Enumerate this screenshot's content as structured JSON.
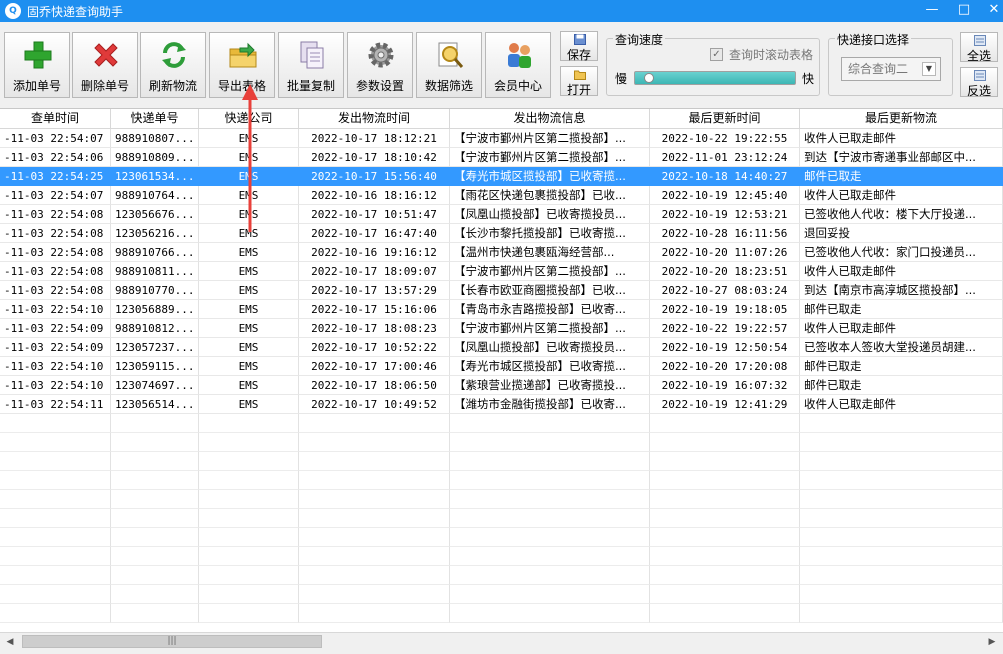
{
  "window": {
    "title": "固乔快递查询助手",
    "app_icon_text": "Q",
    "minimize": "—",
    "maximize": "□",
    "close": "✕"
  },
  "toolbar": {
    "add": "添加单号",
    "delete": "删除单号",
    "refresh": "刷新物流",
    "export": "导出表格",
    "batch_copy": "批量复制",
    "settings": "参数设置",
    "filter": "数据筛选",
    "member": "会员中心",
    "save": "保存",
    "open": "打开"
  },
  "speed": {
    "title": "查询速度",
    "scroll_label": "查询时滚动表格",
    "scroll_checked": true,
    "slow": "慢",
    "fast": "快",
    "level": 0.03
  },
  "api": {
    "title": "快递接口选择",
    "selected": "综合查询二"
  },
  "select": {
    "all": "全选",
    "invert": "反选"
  },
  "colors": {
    "titlebar": "#1e8ff0",
    "selection": "#3399ff",
    "annotation_arrow": "#e8403a"
  },
  "table": {
    "columns": [
      "查单时间",
      "快递单号",
      "快递公司",
      "发出物流时间",
      "发出物流信息",
      "最后更新时间",
      "最后更新物流"
    ],
    "rows": [
      [
        "-11-03 22:54:07",
        "988910807...",
        "EMS",
        "2022-10-17 18:12:21",
        "【宁波市鄞州片区第二揽投部】...",
        "2022-10-22 19:22:55",
        "收件人已取走邮件"
      ],
      [
        "-11-03 22:54:06",
        "988910809...",
        "EMS",
        "2022-10-17 18:10:42",
        "【宁波市鄞州片区第二揽投部】...",
        "2022-11-01 23:12:24",
        "到达【宁波市寄递事业部邮区中..."
      ],
      [
        "-11-03 22:54:25",
        "123061534...",
        "EMS",
        "2022-10-17 15:56:40",
        "【寿光市城区揽投部】已收寄揽...",
        "2022-10-18 14:40:27",
        "邮件已取走"
      ],
      [
        "-11-03 22:54:07",
        "988910764...",
        "EMS",
        "2022-10-16 18:16:12",
        "【雨花区快递包裹揽投部】已收...",
        "2022-10-19 12:45:40",
        "收件人已取走邮件"
      ],
      [
        "-11-03 22:54:08",
        "123056676...",
        "EMS",
        "2022-10-17 10:51:47",
        "【凤凰山揽投部】已收寄揽投员...",
        "2022-10-19 12:53:21",
        "已签收他人代收：楼下大厅投递..."
      ],
      [
        "-11-03 22:54:08",
        "123056216...",
        "EMS",
        "2022-10-17 16:47:40",
        "【长沙市黎托揽投部】已收寄揽...",
        "2022-10-28 16:11:56",
        "退回妥投"
      ],
      [
        "-11-03 22:54:08",
        "988910766...",
        "EMS",
        "2022-10-16 19:16:12",
        "【温州市快递包裹瓯海经营部...",
        "2022-10-20 11:07:26",
        "已签收他人代收：家门口投递员..."
      ],
      [
        "-11-03 22:54:08",
        "988910811...",
        "EMS",
        "2022-10-17 18:09:07",
        "【宁波市鄞州片区第二揽投部】...",
        "2022-10-20 18:23:51",
        "收件人已取走邮件"
      ],
      [
        "-11-03 22:54:08",
        "988910770...",
        "EMS",
        "2022-10-17 13:57:29",
        "【长春市欧亚商圈揽投部】已收...",
        "2022-10-27 08:03:24",
        "到达【南京市高淳城区揽投部】..."
      ],
      [
        "-11-03 22:54:10",
        "123056889...",
        "EMS",
        "2022-10-17 15:16:06",
        "【青岛市永吉路揽投部】已收寄...",
        "2022-10-19 19:18:05",
        "邮件已取走"
      ],
      [
        "-11-03 22:54:09",
        "988910812...",
        "EMS",
        "2022-10-17 18:08:23",
        "【宁波市鄞州片区第二揽投部】...",
        "2022-10-22 19:22:57",
        "收件人已取走邮件"
      ],
      [
        "-11-03 22:54:09",
        "123057237...",
        "EMS",
        "2022-10-17 10:52:22",
        "【凤凰山揽投部】已收寄揽投员...",
        "2022-10-19 12:50:54",
        "已签收本人签收大堂投递员胡建..."
      ],
      [
        "-11-03 22:54:10",
        "123059115...",
        "EMS",
        "2022-10-17 17:00:46",
        "【寿光市城区揽投部】已收寄揽...",
        "2022-10-20 17:20:08",
        "邮件已取走"
      ],
      [
        "-11-03 22:54:10",
        "123074697...",
        "EMS",
        "2022-10-17 18:06:50",
        "【紫琅营业揽递部】已收寄揽投...",
        "2022-10-19 16:07:32",
        "邮件已取走"
      ],
      [
        "-11-03 22:54:11",
        "123056514...",
        "EMS",
        "2022-10-17 10:49:52",
        "【潍坊市金融街揽投部】已收寄...",
        "2022-10-19 12:41:29",
        "收件人已取走邮件"
      ]
    ],
    "selected_row": 2
  },
  "scrollbar": {
    "left_arrow": "◀",
    "right_arrow": "▶",
    "grip": "|||"
  }
}
